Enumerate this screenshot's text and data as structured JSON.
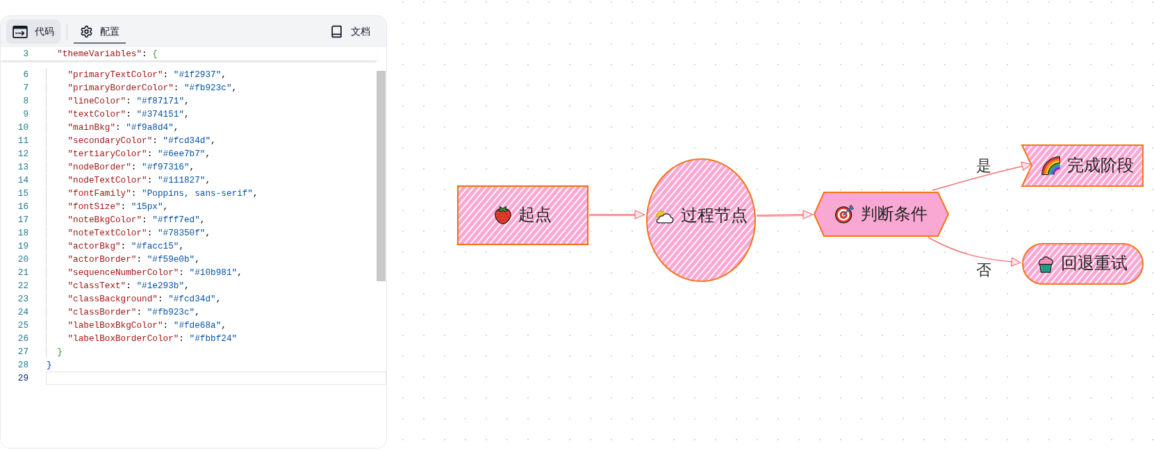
{
  "toolbar": {
    "tabs": [
      {
        "label": "代码",
        "selected": false,
        "hovered": true
      },
      {
        "label": "配置",
        "selected": true,
        "hovered": false
      }
    ],
    "docs_link": {
      "label": "文档"
    }
  },
  "editor": {
    "sticky_line": {
      "number": "3",
      "kind": "object_open",
      "tokens": [
        {
          "kind": "key",
          "text": "\"themeVariables\""
        },
        {
          "kind": "punct",
          "text": ": "
        },
        {
          "kind": "bracket_inner",
          "text": "{"
        }
      ]
    },
    "lines": [
      {
        "number": "6",
        "kind": "member",
        "active": false,
        "tokens": [
          {
            "kind": "key",
            "text": "\"primaryTextColor\""
          },
          {
            "kind": "punct",
            "text": ": "
          },
          {
            "kind": "string",
            "text": "\"#1f2937\""
          },
          {
            "kind": "punct",
            "text": ","
          }
        ]
      },
      {
        "number": "7",
        "kind": "member",
        "active": false,
        "tokens": [
          {
            "kind": "key",
            "text": "\"primaryBorderColor\""
          },
          {
            "kind": "punct",
            "text": ": "
          },
          {
            "kind": "string",
            "text": "\"#fb923c\""
          },
          {
            "kind": "punct",
            "text": ","
          }
        ]
      },
      {
        "number": "8",
        "kind": "member",
        "active": false,
        "tokens": [
          {
            "kind": "key",
            "text": "\"lineColor\""
          },
          {
            "kind": "punct",
            "text": ": "
          },
          {
            "kind": "string",
            "text": "\"#f87171\""
          },
          {
            "kind": "punct",
            "text": ","
          }
        ]
      },
      {
        "number": "9",
        "kind": "member",
        "active": false,
        "tokens": [
          {
            "kind": "key",
            "text": "\"textColor\""
          },
          {
            "kind": "punct",
            "text": ": "
          },
          {
            "kind": "string",
            "text": "\"#374151\""
          },
          {
            "kind": "punct",
            "text": ","
          }
        ]
      },
      {
        "number": "10",
        "kind": "member",
        "active": false,
        "tokens": [
          {
            "kind": "key",
            "text": "\"mainBkg\""
          },
          {
            "kind": "punct",
            "text": ": "
          },
          {
            "kind": "string",
            "text": "\"#f9a8d4\""
          },
          {
            "kind": "punct",
            "text": ","
          }
        ]
      },
      {
        "number": "11",
        "kind": "member",
        "active": false,
        "tokens": [
          {
            "kind": "key",
            "text": "\"secondaryColor\""
          },
          {
            "kind": "punct",
            "text": ": "
          },
          {
            "kind": "string",
            "text": "\"#fcd34d\""
          },
          {
            "kind": "punct",
            "text": ","
          }
        ]
      },
      {
        "number": "12",
        "kind": "member",
        "active": false,
        "tokens": [
          {
            "kind": "key",
            "text": "\"tertiaryColor\""
          },
          {
            "kind": "punct",
            "text": ": "
          },
          {
            "kind": "string",
            "text": "\"#6ee7b7\""
          },
          {
            "kind": "punct",
            "text": ","
          }
        ]
      },
      {
        "number": "13",
        "kind": "member",
        "active": false,
        "tokens": [
          {
            "kind": "key",
            "text": "\"nodeBorder\""
          },
          {
            "kind": "punct",
            "text": ": "
          },
          {
            "kind": "string",
            "text": "\"#f97316\""
          },
          {
            "kind": "punct",
            "text": ","
          }
        ]
      },
      {
        "number": "14",
        "kind": "member",
        "active": false,
        "tokens": [
          {
            "kind": "key",
            "text": "\"nodeTextColor\""
          },
          {
            "kind": "punct",
            "text": ": "
          },
          {
            "kind": "string",
            "text": "\"#111827\""
          },
          {
            "kind": "punct",
            "text": ","
          }
        ]
      },
      {
        "number": "15",
        "kind": "member",
        "active": false,
        "tokens": [
          {
            "kind": "key",
            "text": "\"fontFamily\""
          },
          {
            "kind": "punct",
            "text": ": "
          },
          {
            "kind": "string",
            "text": "\"Poppins, sans-serif\""
          },
          {
            "kind": "punct",
            "text": ","
          }
        ]
      },
      {
        "number": "16",
        "kind": "member",
        "active": false,
        "tokens": [
          {
            "kind": "key",
            "text": "\"fontSize\""
          },
          {
            "kind": "punct",
            "text": ": "
          },
          {
            "kind": "string",
            "text": "\"15px\""
          },
          {
            "kind": "punct",
            "text": ","
          }
        ]
      },
      {
        "number": "17",
        "kind": "member",
        "active": false,
        "tokens": [
          {
            "kind": "key",
            "text": "\"noteBkgColor\""
          },
          {
            "kind": "punct",
            "text": ": "
          },
          {
            "kind": "string",
            "text": "\"#fff7ed\""
          },
          {
            "kind": "punct",
            "text": ","
          }
        ]
      },
      {
        "number": "18",
        "kind": "member",
        "active": false,
        "tokens": [
          {
            "kind": "key",
            "text": "\"noteTextColor\""
          },
          {
            "kind": "punct",
            "text": ": "
          },
          {
            "kind": "string",
            "text": "\"#78350f\""
          },
          {
            "kind": "punct",
            "text": ","
          }
        ]
      },
      {
        "number": "19",
        "kind": "member",
        "active": false,
        "tokens": [
          {
            "kind": "key",
            "text": "\"actorBkg\""
          },
          {
            "kind": "punct",
            "text": ": "
          },
          {
            "kind": "string",
            "text": "\"#facc15\""
          },
          {
            "kind": "punct",
            "text": ","
          }
        ]
      },
      {
        "number": "20",
        "kind": "member",
        "active": false,
        "tokens": [
          {
            "kind": "key",
            "text": "\"actorBorder\""
          },
          {
            "kind": "punct",
            "text": ": "
          },
          {
            "kind": "string",
            "text": "\"#f59e0b\""
          },
          {
            "kind": "punct",
            "text": ","
          }
        ]
      },
      {
        "number": "21",
        "kind": "member",
        "active": false,
        "tokens": [
          {
            "kind": "key",
            "text": "\"sequenceNumberColor\""
          },
          {
            "kind": "punct",
            "text": ": "
          },
          {
            "kind": "string",
            "text": "\"#10b981\""
          },
          {
            "kind": "punct",
            "text": ","
          }
        ]
      },
      {
        "number": "22",
        "kind": "member",
        "active": false,
        "tokens": [
          {
            "kind": "key",
            "text": "\"classText\""
          },
          {
            "kind": "punct",
            "text": ": "
          },
          {
            "kind": "string",
            "text": "\"#1e293b\""
          },
          {
            "kind": "punct",
            "text": ","
          }
        ]
      },
      {
        "number": "23",
        "kind": "member",
        "active": false,
        "tokens": [
          {
            "kind": "key",
            "text": "\"classBackground\""
          },
          {
            "kind": "punct",
            "text": ": "
          },
          {
            "kind": "string",
            "text": "\"#fcd34d\""
          },
          {
            "kind": "punct",
            "text": ","
          }
        ]
      },
      {
        "number": "24",
        "kind": "member",
        "active": false,
        "tokens": [
          {
            "kind": "key",
            "text": "\"classBorder\""
          },
          {
            "kind": "punct",
            "text": ": "
          },
          {
            "kind": "string",
            "text": "\"#fb923c\""
          },
          {
            "kind": "punct",
            "text": ","
          }
        ]
      },
      {
        "number": "25",
        "kind": "member",
        "active": false,
        "tokens": [
          {
            "kind": "key",
            "text": "\"labelBoxBkgColor\""
          },
          {
            "kind": "punct",
            "text": ": "
          },
          {
            "kind": "string",
            "text": "\"#fde68a\""
          },
          {
            "kind": "punct",
            "text": ","
          }
        ]
      },
      {
        "number": "26",
        "kind": "member",
        "active": false,
        "tokens": [
          {
            "kind": "key",
            "text": "\"labelBoxBorderColor\""
          },
          {
            "kind": "punct",
            "text": ": "
          },
          {
            "kind": "string",
            "text": "\"#fbbf24\""
          }
        ]
      },
      {
        "number": "27",
        "kind": "object_close",
        "active": false,
        "tokens": [
          {
            "kind": "bracket_inner",
            "text": "}"
          }
        ]
      },
      {
        "number": "28",
        "kind": "root_close",
        "active": false,
        "tokens": [
          {
            "kind": "bracket_outer",
            "text": "}"
          }
        ]
      },
      {
        "number": "29",
        "kind": "blank",
        "active": true
      }
    ]
  },
  "diagram": {
    "nodes": [
      {
        "label": "起点",
        "kind": "rect",
        "hatched": true
      },
      {
        "label": "过程节点",
        "kind": "circle",
        "hatched": true
      },
      {
        "label": "判断条件",
        "kind": "hexagon",
        "hatched": false
      },
      {
        "label": "完成阶段",
        "kind": "flag",
        "hatched": true
      },
      {
        "label": "回退重试",
        "kind": "stadium",
        "hatched": true
      }
    ],
    "edges": [
      {
        "kind": "straight"
      },
      {
        "kind": "straight"
      },
      {
        "kind": "curve",
        "label": "是"
      },
      {
        "kind": "curve",
        "label": "否"
      }
    ]
  }
}
